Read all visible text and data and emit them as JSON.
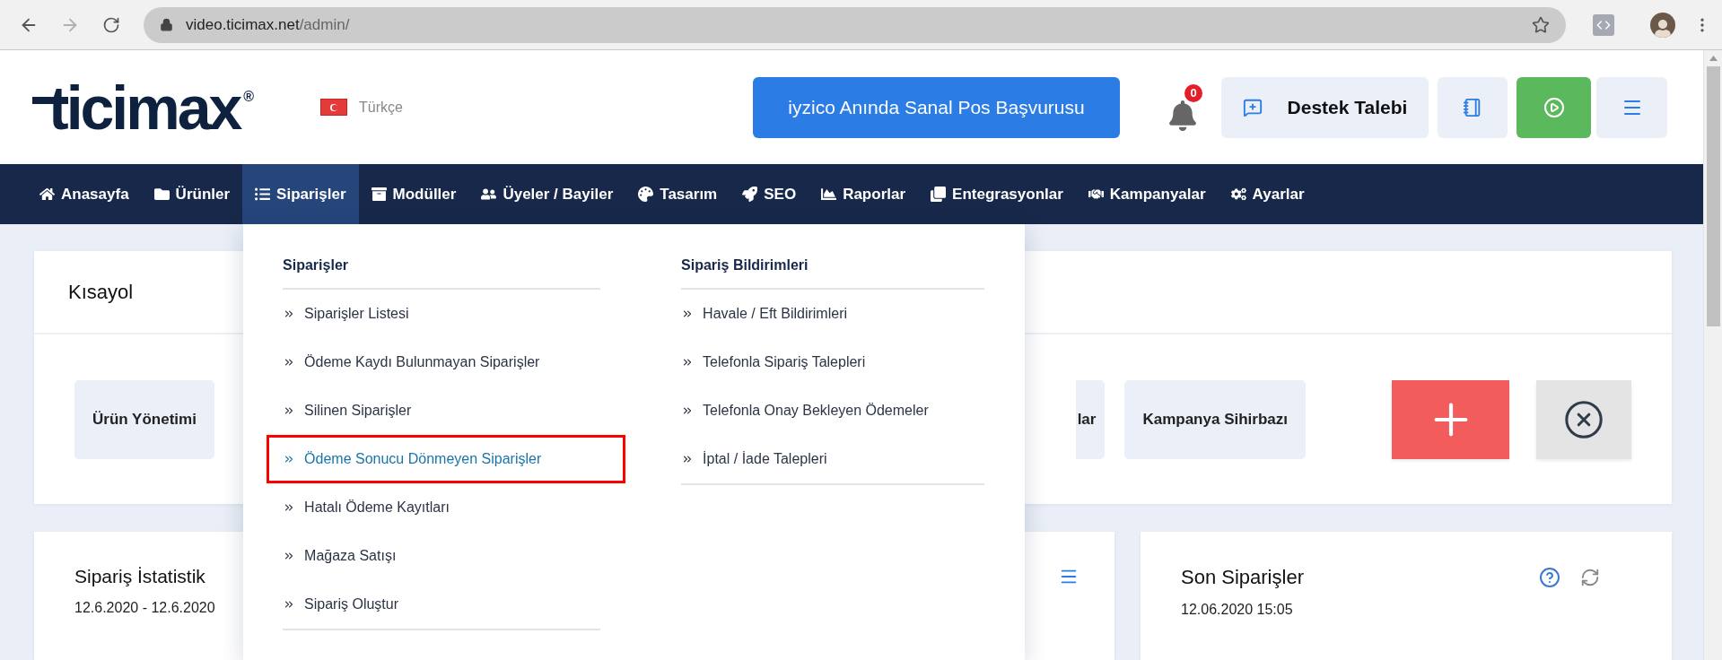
{
  "browser": {
    "url_host": "video.ticimax.net",
    "url_path": "/admin/",
    "forward_disabled": true
  },
  "header": {
    "logo": {
      "text": "ticimax",
      "mark": "®"
    },
    "language": "Türkçe",
    "promo_button": "iyzico Anında Sanal Pos Başvurusu",
    "notifications": "0",
    "support_button": "Destek Talebi"
  },
  "nav": [
    {
      "label": "Anasayfa",
      "selected": false
    },
    {
      "label": "Ürünler",
      "selected": false
    },
    {
      "label": "Siparişler",
      "selected": true
    },
    {
      "label": "Modüller",
      "selected": false
    },
    {
      "label": "Üyeler / Bayiler",
      "selected": false
    },
    {
      "label": "Tasarım",
      "selected": false
    },
    {
      "label": "SEO",
      "selected": false
    },
    {
      "label": "Raporlar",
      "selected": false
    },
    {
      "label": "Entegrasyonlar",
      "selected": false
    },
    {
      "label": "Kampanyalar",
      "selected": false
    },
    {
      "label": "Ayarlar",
      "selected": false
    }
  ],
  "dropdown": {
    "columns": [
      {
        "heading": "Siparişler",
        "items": [
          {
            "label": "Siparişler Listesi",
            "highlighted": false
          },
          {
            "label": "Ödeme Kaydı Bulunmayan Siparişler",
            "highlighted": false
          },
          {
            "label": "Silinen Siparişler",
            "highlighted": false
          },
          {
            "label": "Ödeme Sonucu Dönmeyen Siparişler",
            "highlighted": true
          },
          {
            "label": "Hatalı Ödeme Kayıtları",
            "highlighted": false
          },
          {
            "label": "Mağaza Satışı",
            "highlighted": false
          },
          {
            "label": "Sipariş Oluştur",
            "highlighted": false
          }
        ]
      },
      {
        "heading": "Sipariş Bildirimleri",
        "items": [
          {
            "label": "Havale / Eft Bildirimleri",
            "highlighted": false
          },
          {
            "label": "Telefonla Sipariş Talepleri",
            "highlighted": false
          },
          {
            "label": "Telefonla Onay Bekleyen Ödemeler",
            "highlighted": false
          },
          {
            "label": "İptal / İade Talepleri",
            "highlighted": false
          }
        ]
      }
    ]
  },
  "shortcuts": {
    "title": "Kısayol",
    "items": [
      {
        "label": "Ürün Yönetimi",
        "kind": "full"
      },
      {
        "label": "lar",
        "kind": "partial"
      },
      {
        "label": "Kampanya Sihirbazı",
        "kind": "full"
      }
    ]
  },
  "stats_card": {
    "title": "Sipariş İstatistik",
    "date": "12.6.2020 - 12.6.2020"
  },
  "orders_card": {
    "title": "Son Siparişler",
    "date": "12.06.2020 15:05"
  }
}
